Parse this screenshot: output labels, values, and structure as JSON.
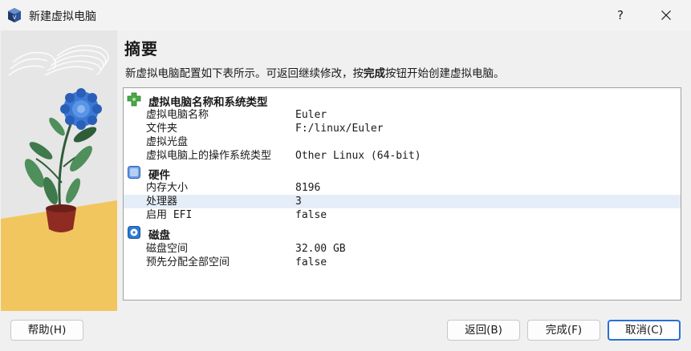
{
  "window": {
    "title": "新建虚拟电脑",
    "help_glyph": "?",
    "close_glyph": "✕"
  },
  "summary": {
    "heading": "摘要",
    "desc_prefix": "新虚拟电脑配置如下表所示。可返回继续修改，按",
    "desc_emphasis": "完成",
    "desc_suffix": "按钮开始创建虚拟电脑。"
  },
  "groups": {
    "general": {
      "label": "虚拟电脑名称和系统类型",
      "icon": "green-puzzle-icon",
      "items": [
        {
          "key": "虚拟电脑名称",
          "value": "Euler"
        },
        {
          "key": "文件夹",
          "value": "F:/linux/Euler"
        },
        {
          "key": "虚拟光盘",
          "value": ""
        },
        {
          "key": "虚拟电脑上的操作系统类型",
          "value": "Other Linux (64-bit)"
        }
      ]
    },
    "hardware": {
      "label": "硬件",
      "icon": "chip-icon",
      "items": [
        {
          "key": "内存大小",
          "value": "8196"
        },
        {
          "key": "处理器",
          "value": "3"
        },
        {
          "key": "启用 EFI",
          "value": "false"
        }
      ]
    },
    "disk": {
      "label": "磁盘",
      "icon": "disk-icon",
      "items": [
        {
          "key": "磁盘空间",
          "value": "32.00 GB"
        },
        {
          "key": "预先分配全部空间",
          "value": "false"
        }
      ]
    }
  },
  "buttons": {
    "help": "帮助(H)",
    "back": "返回(B)",
    "finish": "完成(F)",
    "cancel": "取消(C)"
  },
  "colors": {
    "accent": "#2a6fd6",
    "selected_row": "#e5eef8",
    "art_wall": "#e8e8e8",
    "art_floor": "#f2c65e"
  }
}
